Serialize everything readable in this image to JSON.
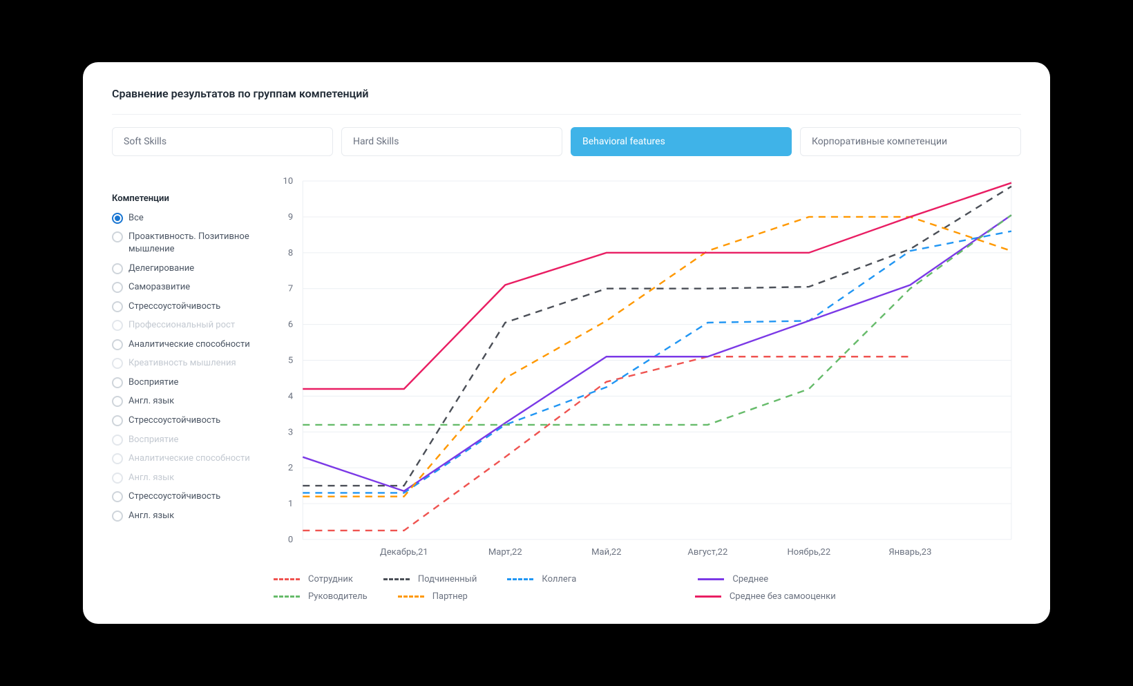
{
  "title": "Сравнение результатов по группам компетенций",
  "tabs": [
    {
      "label": "Soft Skills",
      "active": false
    },
    {
      "label": "Hard Skills",
      "active": false
    },
    {
      "label": "Behavioral features",
      "active": true
    },
    {
      "label": "Корпоративные компетенции",
      "active": false
    }
  ],
  "sidebar": {
    "title": "Компетенции",
    "items": [
      {
        "label": "Все",
        "selected": true,
        "disabled": false
      },
      {
        "label": "Проактивность. Позитивное мышление",
        "selected": false,
        "disabled": false
      },
      {
        "label": "Делегирование",
        "selected": false,
        "disabled": false
      },
      {
        "label": "Саморазвитие",
        "selected": false,
        "disabled": false
      },
      {
        "label": "Стрессоустойчивость",
        "selected": false,
        "disabled": false
      },
      {
        "label": "Профессиональный рост",
        "selected": false,
        "disabled": true
      },
      {
        "label": "Аналитические способности",
        "selected": false,
        "disabled": false
      },
      {
        "label": "Креативность мышления",
        "selected": false,
        "disabled": true
      },
      {
        "label": "Восприятие",
        "selected": false,
        "disabled": false
      },
      {
        "label": "Англ. язык",
        "selected": false,
        "disabled": false
      },
      {
        "label": "Стрессоустойчивость",
        "selected": false,
        "disabled": false
      },
      {
        "label": "Восприятие",
        "selected": false,
        "disabled": true
      },
      {
        "label": "Аналитические способности",
        "selected": false,
        "disabled": true
      },
      {
        "label": "Англ. язык",
        "selected": false,
        "disabled": true
      },
      {
        "label": "Стрессоустойчивость",
        "selected": false,
        "disabled": false
      },
      {
        "label": "Англ. язык",
        "selected": false,
        "disabled": false
      }
    ]
  },
  "chart_data": {
    "type": "line",
    "title": "",
    "xlabel": "",
    "ylabel": "",
    "ylim": [
      0,
      10
    ],
    "yticks": [
      0,
      1,
      2,
      3,
      4,
      5,
      6,
      7,
      8,
      9,
      10
    ],
    "categories": [
      "Декабрь,21",
      "Март,22",
      "Май,22",
      "Август,22",
      "Ноябрь,22",
      "Январь,23"
    ],
    "series": [
      {
        "name": "Сотрудник",
        "color": "#ef5350",
        "style": "dashed",
        "values": [
          0.25,
          0.25,
          2.3,
          4.4,
          5.1,
          5.1,
          5.1
        ]
      },
      {
        "name": "Подчиненный",
        "color": "#4b4f57",
        "style": "dashed",
        "values": [
          1.5,
          1.5,
          6.05,
          7.0,
          7.0,
          7.05,
          8.1,
          9.85
        ]
      },
      {
        "name": "Коллега",
        "color": "#2196f3",
        "style": "dashed",
        "values": [
          1.3,
          1.3,
          3.2,
          4.25,
          6.05,
          6.1,
          8.05,
          8.6
        ]
      },
      {
        "name": "Среднее",
        "color": "#7b39e6",
        "style": "solid",
        "values": [
          2.3,
          1.35,
          3.25,
          5.1,
          5.1,
          6.1,
          7.1,
          9.05
        ]
      },
      {
        "name": "Руководитель",
        "color": "#66bb6a",
        "style": "dashed",
        "values": [
          3.2,
          3.2,
          3.2,
          3.2,
          3.2,
          4.2,
          7.0,
          9.05
        ]
      },
      {
        "name": "Партнер",
        "color": "#ff9800",
        "style": "dashed",
        "values": [
          1.2,
          1.2,
          4.5,
          6.1,
          8.05,
          9.0,
          9.0,
          8.05
        ]
      },
      {
        "name": "Среднее без самооценки",
        "color": "#e91e63",
        "style": "solid",
        "values": [
          4.2,
          4.2,
          7.1,
          8.0,
          8.0,
          8.0,
          9.0,
          9.95
        ]
      }
    ]
  },
  "legend": [
    {
      "label": "Сотрудник",
      "color": "#ef5350",
      "style": "dashed"
    },
    {
      "label": "Подчиненный",
      "color": "#4b4f57",
      "style": "dashed"
    },
    {
      "label": "Коллега",
      "color": "#2196f3",
      "style": "dashed"
    },
    {
      "label": "Среднее",
      "color": "#7b39e6",
      "style": "solid"
    },
    {
      "label": "Руководитель",
      "color": "#66bb6a",
      "style": "dashed"
    },
    {
      "label": "Партнер",
      "color": "#ff9800",
      "style": "dashed"
    },
    {
      "label": "Среднее без самооценки",
      "color": "#e91e63",
      "style": "solid"
    }
  ]
}
